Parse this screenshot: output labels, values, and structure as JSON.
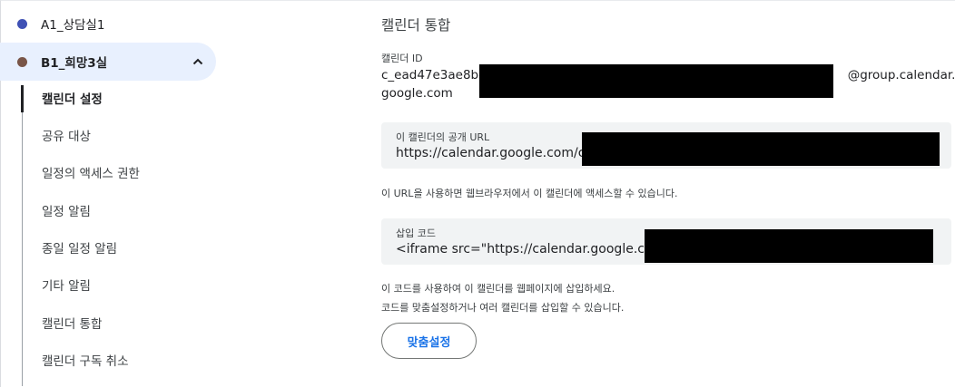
{
  "sidebar": {
    "calendars": [
      {
        "label": "A1_상담실1",
        "color": "#3f51b5"
      },
      {
        "label": "B1_희망3실",
        "color": "#795548"
      }
    ],
    "selected_bg": "#e8f0fe",
    "chevron_icon": "chevron-up-icon",
    "items": [
      {
        "label": "캘린더 설정"
      },
      {
        "label": "공유 대상"
      },
      {
        "label": "일정의 액세스 권한"
      },
      {
        "label": "일정 알림"
      },
      {
        "label": "종일 일정 알림"
      },
      {
        "label": "기타 알림"
      },
      {
        "label": "캘린더 통합"
      },
      {
        "label": "캘린더 구독 취소"
      }
    ]
  },
  "main": {
    "section_title": "캘린더 통합",
    "calendar_id": {
      "label": "캘린더 ID",
      "value_line1_prefix": "c_ead47e3ae8bd",
      "value_line1_suffix": "@group.calendar.",
      "value_line2": "google.com"
    },
    "public_url": {
      "label": "이 캘린더의 공개 URL",
      "value": "https://calendar.google.com/cal"
    },
    "public_url_help": "이 URL을 사용하면 웹브라우저에서 이 캘린더에 액세스할 수 있습니다.",
    "embed_code": {
      "label": "삽입 코드",
      "value": "<iframe src=\"https://calendar.google.com/"
    },
    "embed_help_1": "이 코드를 사용하여 이 캘린더를 웹페이지에 삽입하세요.",
    "embed_help_2": "코드를 맞춤설정하거나 여러 캘린더를 삽입할 수 있습니다.",
    "customize_button": "맞춤설정"
  }
}
